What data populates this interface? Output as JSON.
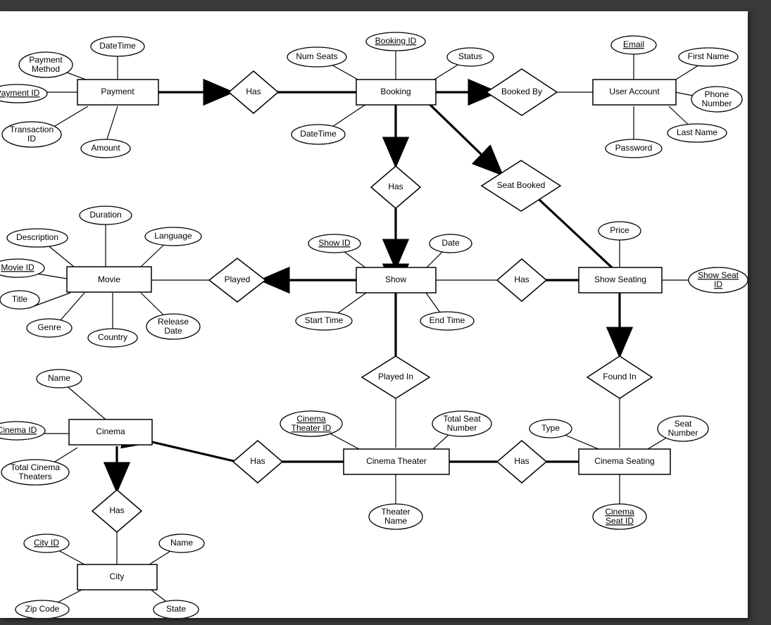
{
  "entities": {
    "payment": "Payment",
    "booking": "Booking",
    "user": "User Account",
    "movie": "Movie",
    "show": "Show",
    "showseating": "Show Seating",
    "cinema": "Cinema",
    "ctheater": "Cinema Theater",
    "cseating": "Cinema Seating",
    "city": "City"
  },
  "relationships": {
    "pay_has": "Has",
    "booked_by": "Booked By",
    "book_has": "Has",
    "seat_booked": "Seat Booked",
    "played": "Played",
    "show_has": "Has",
    "played_in": "Played In",
    "found_in": "Found In",
    "cin_has": "Has",
    "ct_has": "Has",
    "city_has": "Has"
  },
  "attrs": {
    "pay_datetime": "DateTime",
    "pay_method": "Payment\nMethod",
    "pay_id": "Payment ID",
    "pay_txid": "Transaction\nID",
    "pay_amount": "Amount",
    "bk_numseats": "Num Seats",
    "bk_id": "Booking ID",
    "bk_status": "Status",
    "bk_datetime": "DateTime",
    "u_email": "Email",
    "u_first": "First Name",
    "u_phone": "Phone\nNumber",
    "u_last": "Last Name",
    "u_pass": "Password",
    "sh_id": "Show ID",
    "sh_date": "Date",
    "sh_start": "Start Time",
    "sh_end": "End Time",
    "m_dur": "Duration",
    "m_lang": "Language",
    "m_desc": "Description",
    "m_id": "Movie ID",
    "m_title": "Title",
    "m_genre": "Genre",
    "m_rel": "Release\nDate",
    "m_country": "Country",
    "ss_price": "Price",
    "ss_id": "Show Seat\nID",
    "c_name": "Name",
    "c_id": "Cinema ID",
    "c_tot": "Total Cinema\nTheaters",
    "ct_id": "Cinema\nTheater ID",
    "ct_total": "Total Seat\nNumber",
    "ct_name": "Theater\nName",
    "cs_type": "Type",
    "cs_snum": "Seat\nNumber",
    "cs_id": "Cinema\nSeat ID",
    "city_id": "City ID",
    "city_name": "Name",
    "city_zip": "Zip Code",
    "city_state": "State"
  }
}
